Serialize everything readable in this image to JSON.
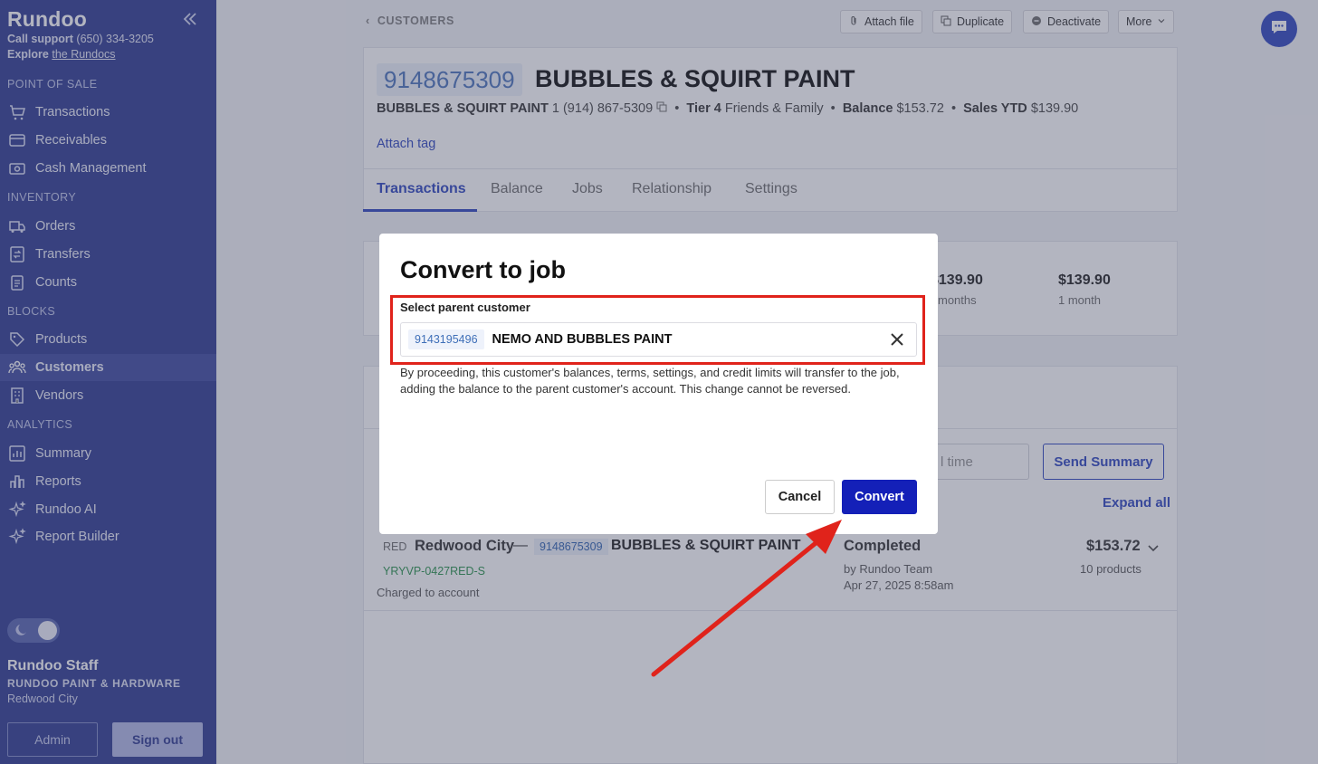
{
  "sidebar": {
    "logo": "Rundoo",
    "support_label": "Call support",
    "support_phone": "(650) 334-3205",
    "explore_label": "Explore",
    "explore_link": "the Rundocs",
    "sections": {
      "pos": "POINT OF SALE",
      "inventory": "INVENTORY",
      "blocks": "BLOCKS",
      "analytics": "ANALYTICS"
    },
    "items": {
      "transactions": "Transactions",
      "receivables": "Receivables",
      "cash": "Cash Management",
      "orders": "Orders",
      "transfers": "Transfers",
      "counts": "Counts",
      "products": "Products",
      "customers": "Customers",
      "vendors": "Vendors",
      "summary": "Summary",
      "reports": "Reports",
      "ai": "Rundoo AI",
      "builder": "Report Builder"
    },
    "user_name": "Rundoo Staff",
    "store_name": "RUNDOO PAINT & HARDWARE",
    "store_city": "Redwood City",
    "admin_label": "Admin",
    "signout_label": "Sign out"
  },
  "header": {
    "breadcrumb": "CUSTOMERS",
    "attach_file": "Attach file",
    "duplicate": "Duplicate",
    "deactivate": "Deactivate",
    "more": "More"
  },
  "customer": {
    "id": "9148675309",
    "name": "BUBBLES & SQUIRT PAINT",
    "sub_name": "BUBBLES & SQUIRT PAINT",
    "phone": "1 (914) 867-5309",
    "tier_label": "Tier 4",
    "tier_value": "Friends & Family",
    "balance_label": "Balance",
    "balance_value": "$153.72",
    "sales_label": "Sales YTD",
    "sales_value": "$139.90",
    "attach_tag": "Attach tag"
  },
  "tabs": [
    "Transactions",
    "Balance",
    "Jobs",
    "Relationship",
    "Settings"
  ],
  "stats": [
    {
      "value": "$139.90",
      "sub": "months"
    },
    {
      "value": "$139.90",
      "sub": "1 month"
    }
  ],
  "controls": {
    "time_placeholder": "l time",
    "send_summary": "Send Summary",
    "expand_all": "Expand all"
  },
  "transaction": {
    "store_code": "RED",
    "store": "Redwood City",
    "dash": "—",
    "customer_id": "9148675309",
    "customer": "BUBBLES & SQUIRT PAINT",
    "ref": "YRYVP-0427RED-S",
    "payment": "Charged to account",
    "status": "Completed",
    "by": "by Rundoo Team",
    "date": "Apr 27, 2025 8:58am",
    "amount": "$153.72",
    "products": "10 products"
  },
  "modal": {
    "title": "Convert to job",
    "field_label": "Select parent customer",
    "selected_id": "9143195496",
    "selected_name": "NEMO AND BUBBLES PAINT",
    "warning": "By proceeding, this customer's balances, terms, settings, and credit limits will transfer to the job, adding the balance to the parent customer's account. This change cannot be reversed.",
    "cancel": "Cancel",
    "convert": "Convert"
  },
  "colors": {
    "sidebar": "#3f4a9a",
    "accent": "#3f55c4",
    "convert_button": "#1420b8",
    "highlight": "#e0231b"
  }
}
